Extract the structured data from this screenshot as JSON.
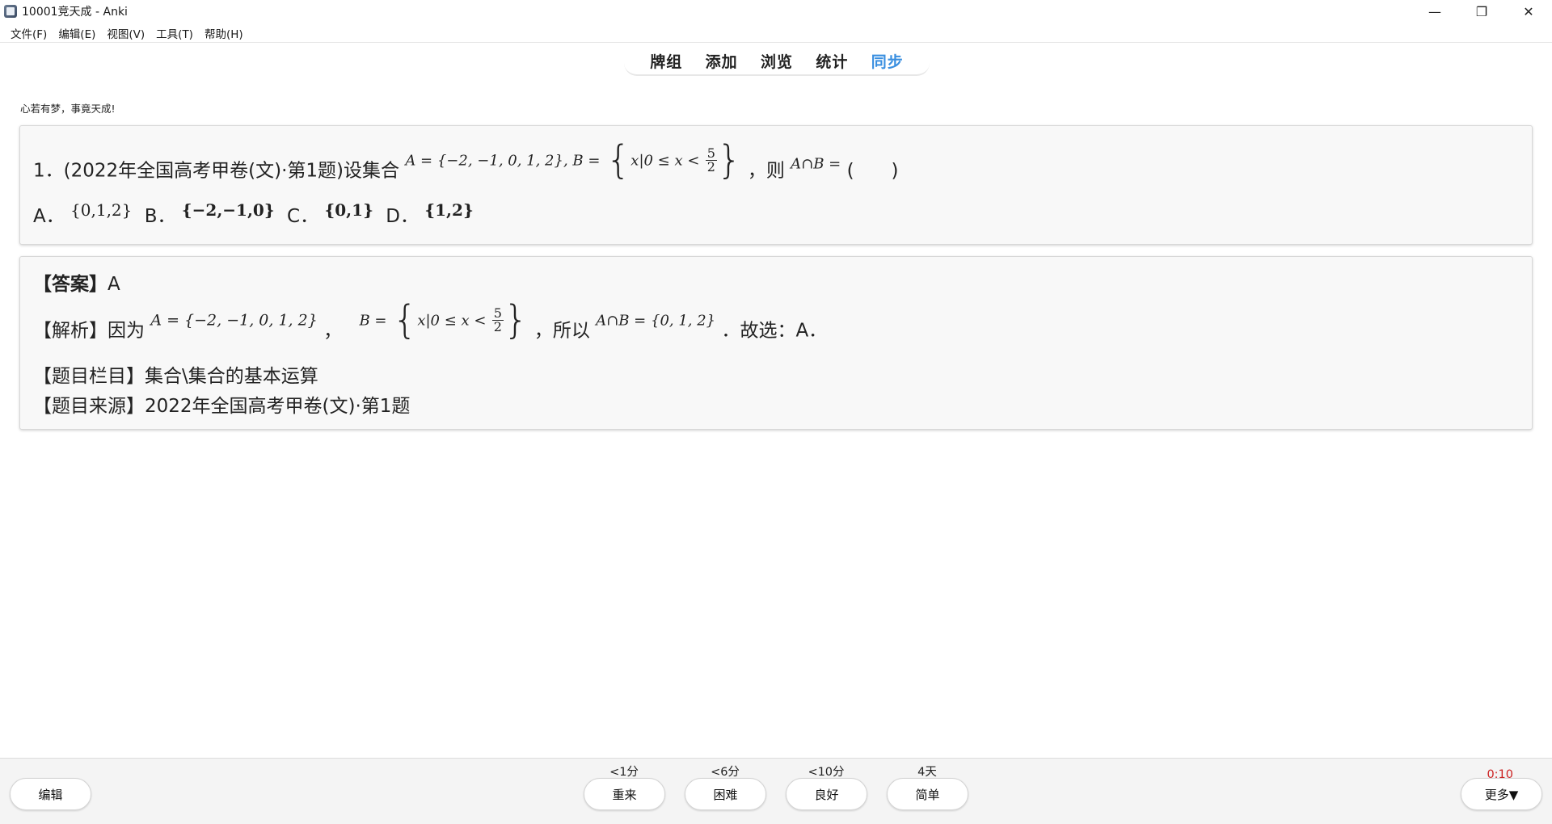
{
  "window": {
    "title": "10001竞天成 - Anki",
    "minimize_glyph": "—",
    "restore_glyph": "❐",
    "close_glyph": "✕"
  },
  "menu": [
    "文件(F)",
    "编辑(E)",
    "视图(V)",
    "工具(T)",
    "帮助(H)"
  ],
  "toolbar": {
    "tabs": [
      "牌组",
      "添加",
      "浏览",
      "统计",
      "同步"
    ],
    "active_tab": "同步",
    "accent_color": "#3a8fe0"
  },
  "motto": "心若有梦，事竟天成!",
  "question": {
    "prefix": "1．(2022年全国高考甲卷(文)·第1题)设集合",
    "setA": "A = {−2, −1, 0, 1, 2}, B =",
    "setB_inner": "x|0 ≤ x <",
    "frac_num": "5",
    "frac_den": "2",
    "middle": "，则",
    "intersection": "A∩B =",
    "paren": "(　　)",
    "options": [
      {
        "label": "A．",
        "value": "{0,1,2}"
      },
      {
        "label": "B．",
        "value": "{−2,−1,0}"
      },
      {
        "label": "C．",
        "value": "{0,1}"
      },
      {
        "label": "D．",
        "value": "{1,2}"
      }
    ]
  },
  "answer": {
    "answer_tag": "【答案】",
    "answer_value": "A",
    "analysis_tag": "【解析】因为",
    "analysis_setA": "A = {−2, −1, 0, 1, 2}",
    "analysis_comma": "，",
    "analysis_setB_prefix": "B =",
    "analysis_setB_inner": "x|0 ≤ x <",
    "analysis_frac_num": "5",
    "analysis_frac_den": "2",
    "analysis_so": "，所以",
    "analysis_result": "A∩B = {0, 1, 2}",
    "analysis_end": "．故选：A．",
    "category": "【题目栏目】集合\\集合的基本运算",
    "source": "【题目来源】2022年全国高考甲卷(文)·第1题"
  },
  "bottom": {
    "edit_label": "编辑",
    "answers": [
      {
        "due": "<1分",
        "label": "重来"
      },
      {
        "due": "<6分",
        "label": "困难"
      },
      {
        "due": "<10分",
        "label": "良好"
      },
      {
        "due": "4天",
        "label": "简单"
      }
    ],
    "timer": "0:10",
    "more_label": "更多▼"
  }
}
